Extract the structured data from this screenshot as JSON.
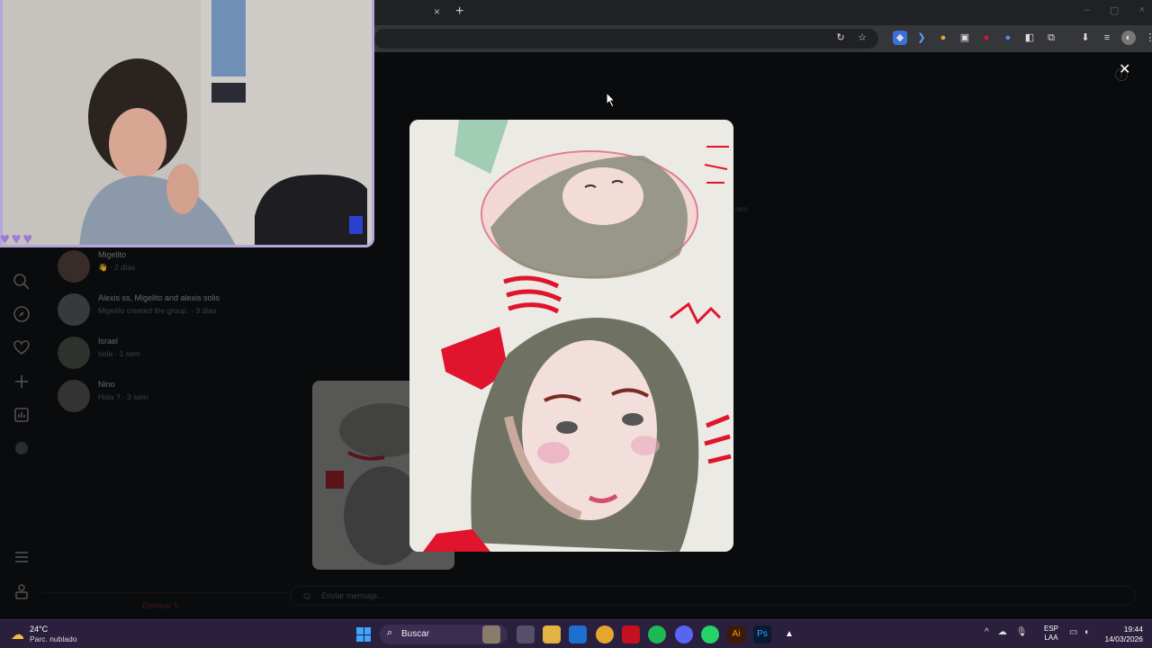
{
  "browser": {
    "tab_close": "×",
    "new_tab": "+",
    "window_controls": [
      "–",
      "▢",
      "×"
    ],
    "extensions": [
      "↻",
      "☆",
      "◆",
      "❯",
      "●",
      "▣",
      "●",
      "●",
      "◧",
      "⧉",
      "⬇",
      "≡",
      "◐",
      "⋮"
    ]
  },
  "sidebar_nav": {
    "icons": [
      "search-icon",
      "explore-icon",
      "heart-icon",
      "create-icon",
      "dashboard-icon",
      "profile-icon",
      "menu-icon",
      "threads-icon"
    ]
  },
  "dm_list": {
    "items": [
      {
        "name": "Migelito",
        "sub": "👋 · 2 días"
      },
      {
        "name": "Alexis ss, Migelito and alexis solis",
        "sub": "Migelito created the group. · 3 días"
      },
      {
        "name": "Israel",
        "sub": "hola · 1 sem"
      },
      {
        "name": "Nino",
        "sub": "Hola ? · 3 sem"
      }
    ],
    "delete_label": "Eliminar 5"
  },
  "message_input": {
    "placeholder": "Enviar mensaje..."
  },
  "background_caption": "ram",
  "overlay": {
    "close": "✕",
    "info": "i"
  },
  "taskbar": {
    "weather_temp": "24°C",
    "weather_desc": "Parc. nublado",
    "search_label": "Buscar",
    "apps": [
      "widgets",
      "task-view",
      "file-explorer",
      "outlook",
      "chrome",
      "app-red",
      "spotify",
      "discord",
      "whatsapp",
      "illustrator",
      "photoshop",
      "app-triangle"
    ],
    "tray": [
      "^",
      "☁",
      "🎙"
    ],
    "lang_line1": "ESP",
    "lang_line2": "LAA",
    "time": "19:44",
    "date": "14/03/2026"
  },
  "colors": {
    "accent_lilac": "#b7a6d8",
    "taskbar": "#2a1f3c",
    "red_ink": "#e0142c"
  }
}
